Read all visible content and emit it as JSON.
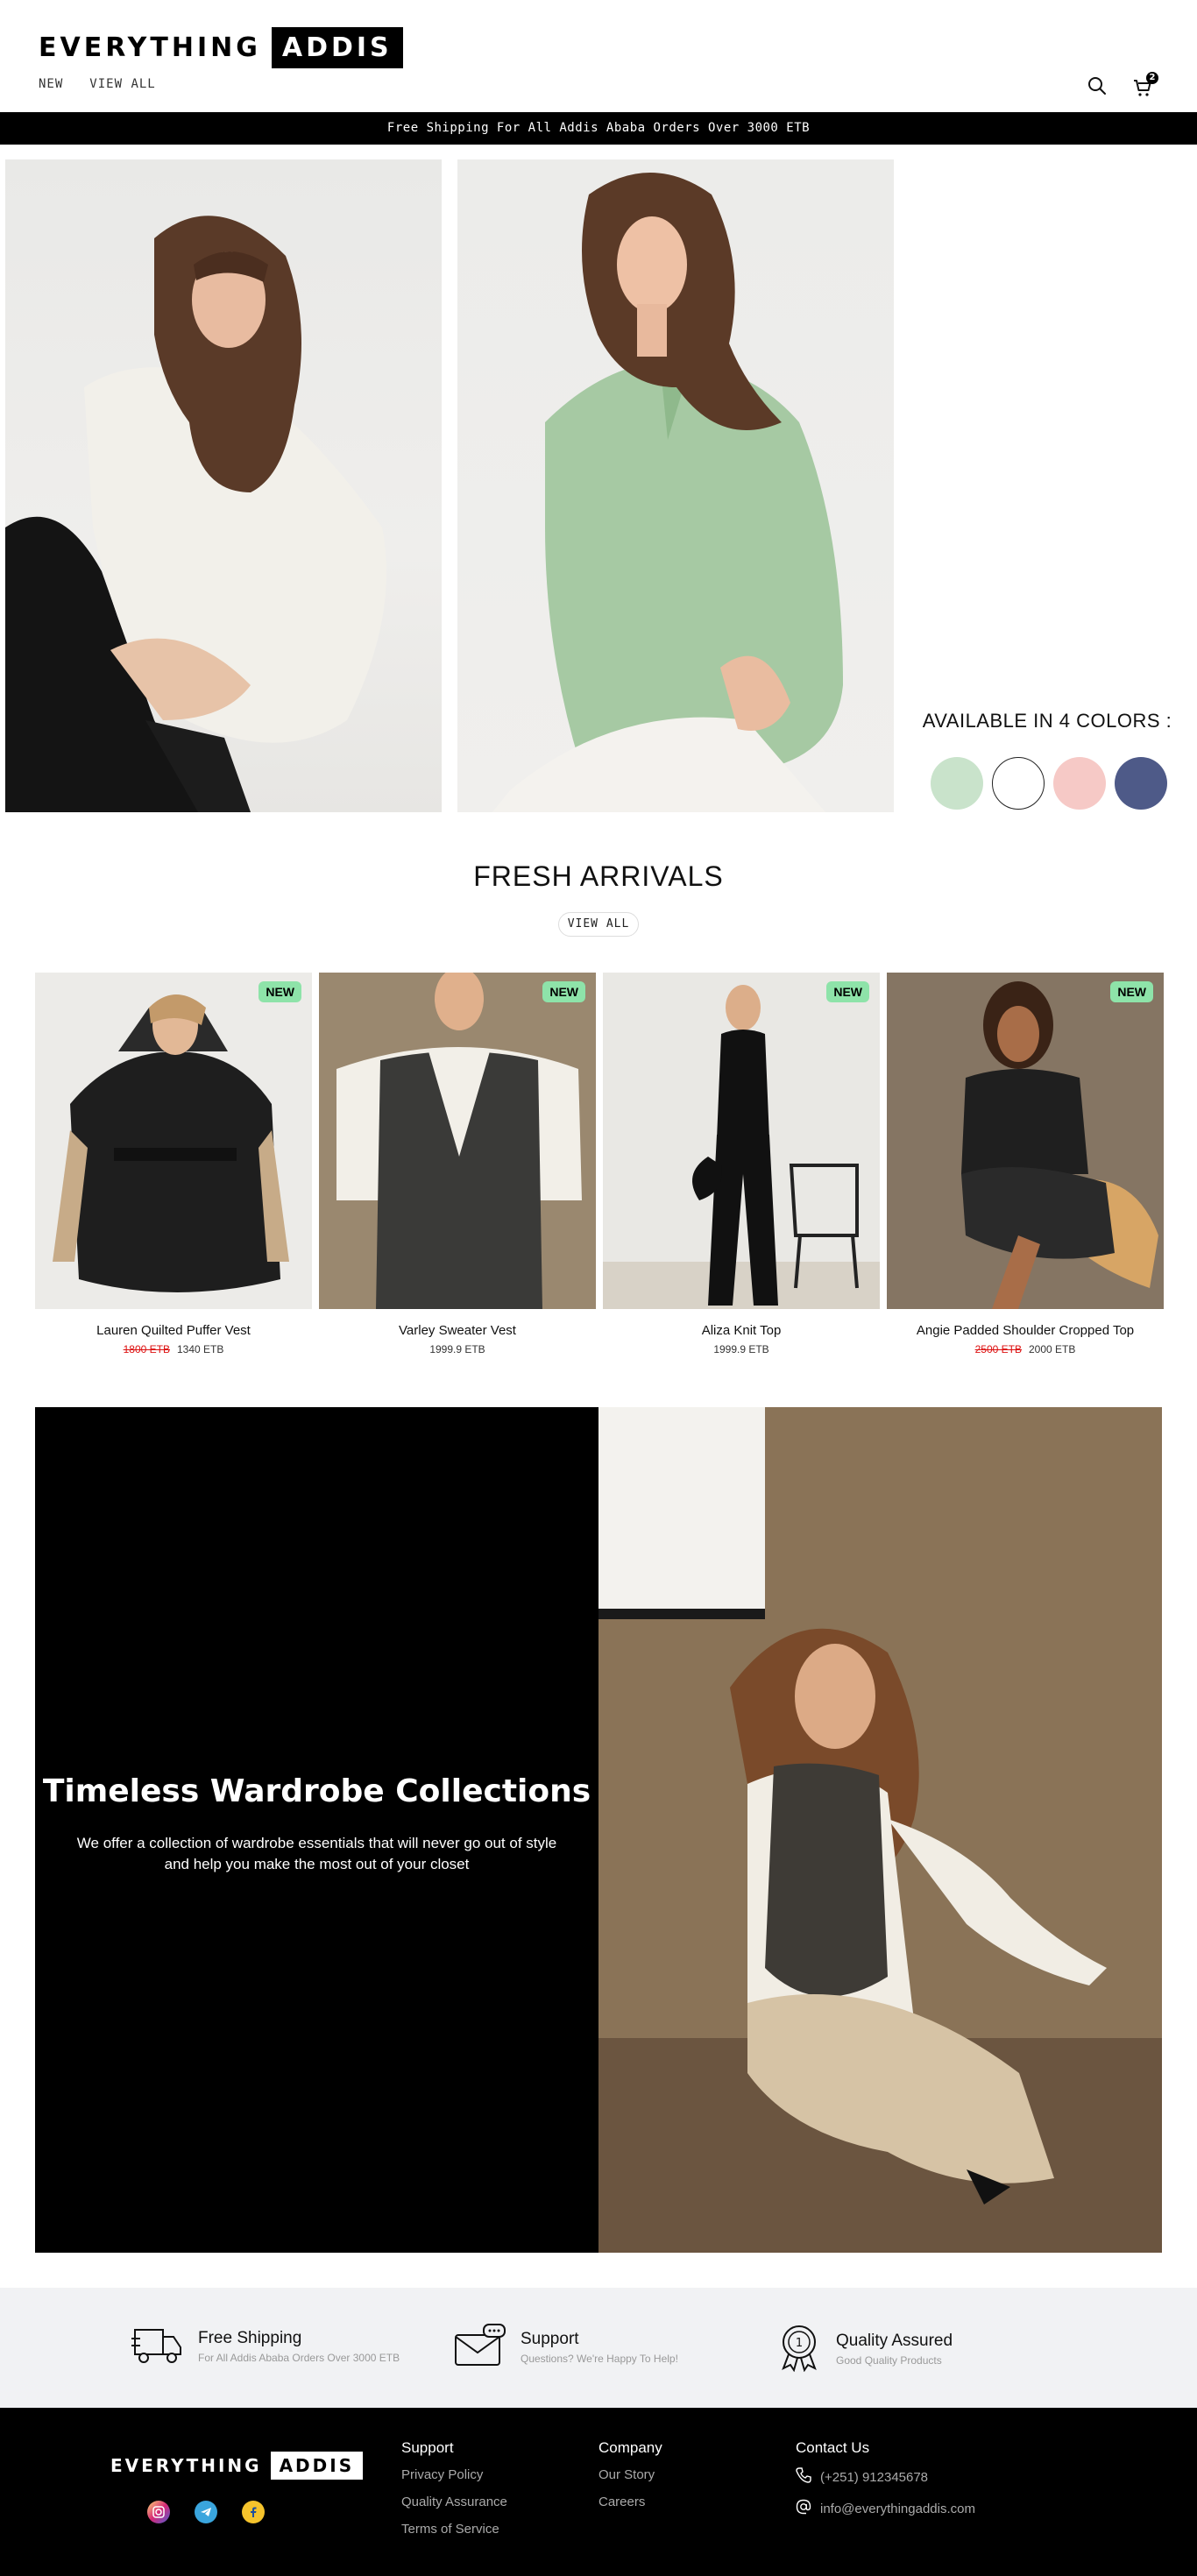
{
  "header": {
    "logo_part1": "EVERYTHING",
    "logo_part2": "ADDIS",
    "nav": [
      {
        "label": "NEW"
      },
      {
        "label": "VIEW ALL"
      }
    ],
    "cart_count": "2",
    "icons": [
      "search-icon",
      "cart-icon"
    ]
  },
  "announcement": "Free Shipping For All Addis Ababa Orders Over 3000 ETB",
  "hero": {
    "colors_title": "AVAILABLE IN 4 COLORS :",
    "swatches": [
      "#c9e3cb",
      "#ffffff",
      "#f6c9c6",
      "#4e5a88"
    ]
  },
  "fresh_arrivals": {
    "title": "FRESH ARRIVALS",
    "view_all": "VIEW ALL",
    "badge": "NEW",
    "products": [
      {
        "name": "Lauren Quilted Puffer Vest",
        "old_price": "1800 ETB",
        "price": "1340 ETB"
      },
      {
        "name": "Varley Sweater Vest",
        "old_price": "",
        "price": "1999.9 ETB"
      },
      {
        "name": "Aliza Knit Top",
        "old_price": "",
        "price": "1999.9 ETB"
      },
      {
        "name": "Angie Padded Shoulder Cropped Top",
        "old_price": "2500 ETB",
        "price": "2000 ETB"
      }
    ]
  },
  "feature": {
    "title": "Timeless Wardrobe Collections",
    "text": "We offer a collection of wardrobe essentials that will never go out of style and help you make the most out of your closet"
  },
  "benefits": [
    {
      "title": "Free Shipping",
      "subtitle": "For All Addis Ababa Orders Over 3000 ETB",
      "icon": "truck-icon"
    },
    {
      "title": "Support",
      "subtitle": "Questions? We're Happy To Help!",
      "icon": "chat-mail-icon"
    },
    {
      "title": "Quality Assured",
      "subtitle": "Good Quality Products",
      "icon": "badge-icon"
    }
  ],
  "footer": {
    "logo_part1": "EVERYTHING",
    "logo_part2": "ADDIS",
    "socials": [
      "instagram-icon",
      "telegram-icon",
      "facebook-icon"
    ],
    "support": {
      "title": "Support",
      "links": [
        "Privacy Policy",
        "Quality Assurance",
        "Terms of Service"
      ]
    },
    "company": {
      "title": "Company",
      "links": [
        "Our Story",
        "Careers"
      ]
    },
    "contact": {
      "title": "Contact Us",
      "phone": "(+251) 912345678",
      "email": "info@everythingaddis.com"
    }
  }
}
